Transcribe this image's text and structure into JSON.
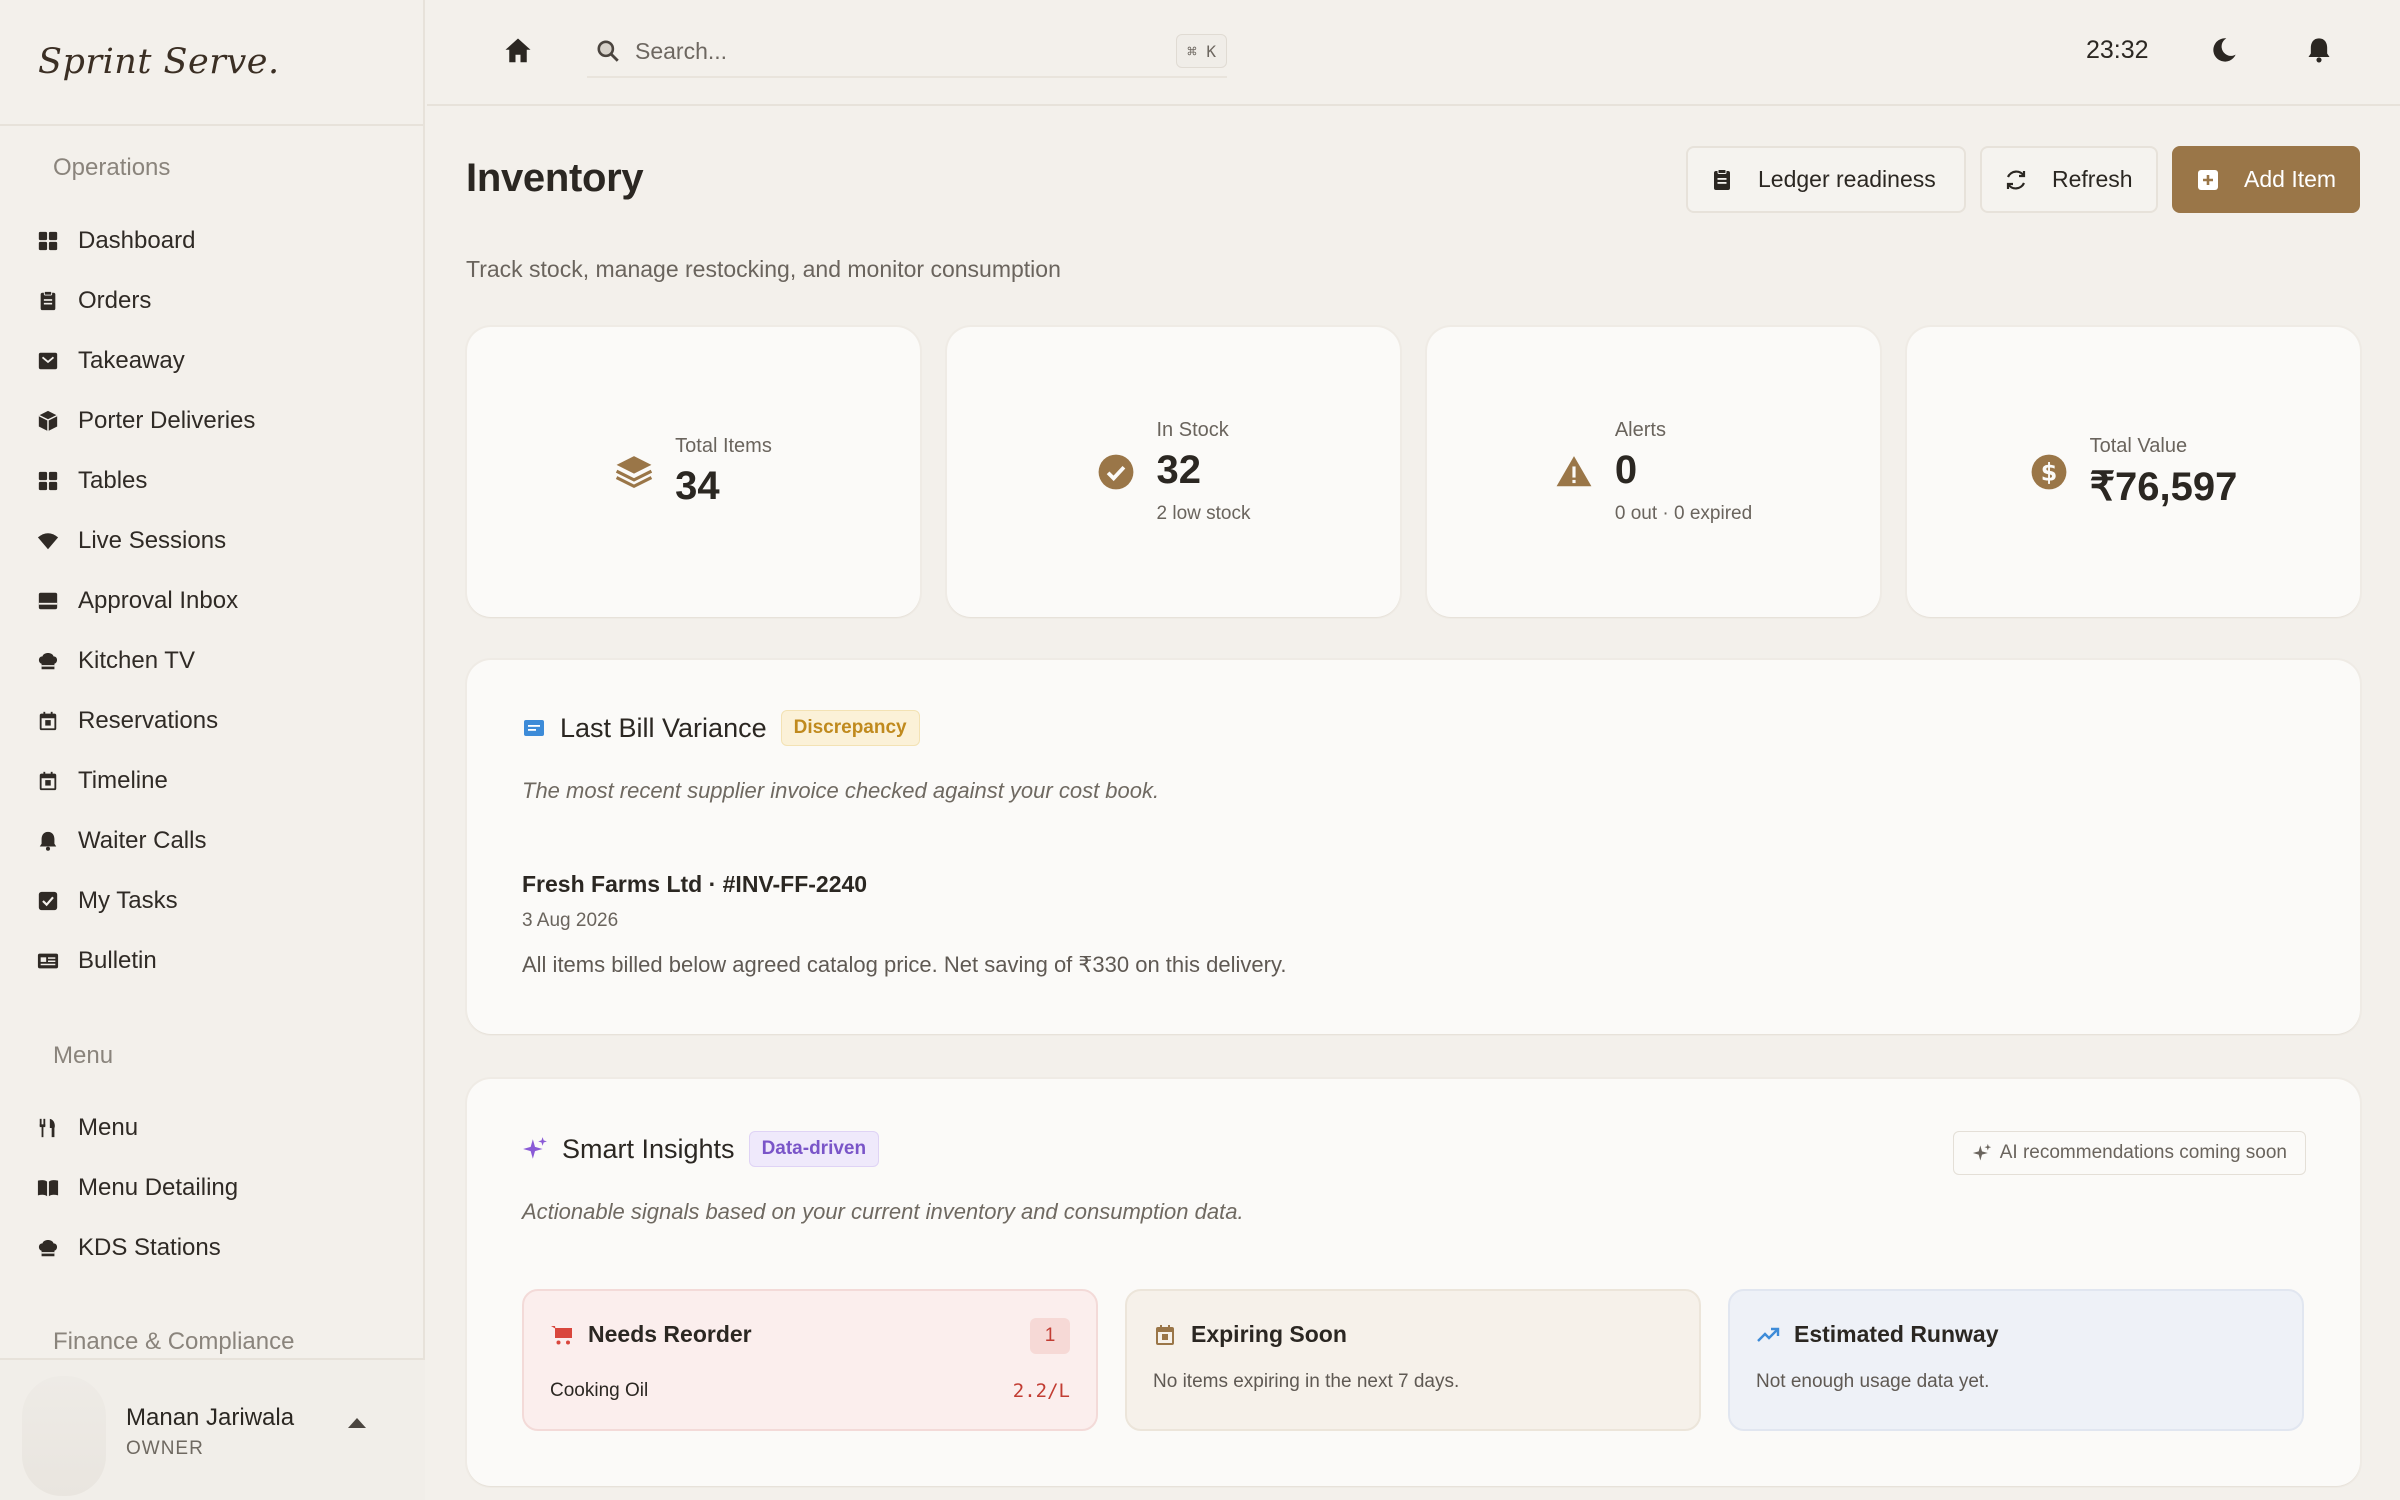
{
  "brand": "Sprint Serve.",
  "sidebar": {
    "sections": [
      {
        "title": "Operations"
      },
      {
        "title": "Menu"
      },
      {
        "title": "Finance & Compliance"
      }
    ],
    "operations": [
      {
        "label": "Dashboard",
        "icon": "grid-icon"
      },
      {
        "label": "Orders",
        "icon": "clipboard-icon"
      },
      {
        "label": "Takeaway",
        "icon": "bag-icon"
      },
      {
        "label": "Porter Deliveries",
        "icon": "box-icon"
      },
      {
        "label": "Tables",
        "icon": "grid-icon"
      },
      {
        "label": "Live Sessions",
        "icon": "wifi-icon"
      },
      {
        "label": "Approval Inbox",
        "icon": "inbox-icon"
      },
      {
        "label": "Kitchen TV",
        "icon": "chef-hat-icon"
      },
      {
        "label": "Reservations",
        "icon": "calendar-icon"
      },
      {
        "label": "Timeline",
        "icon": "calendar-icon"
      },
      {
        "label": "Waiter Calls",
        "icon": "bell-icon"
      },
      {
        "label": "My Tasks",
        "icon": "checkbox-icon"
      },
      {
        "label": "Bulletin",
        "icon": "newspaper-icon"
      }
    ],
    "menu": [
      {
        "label": "Menu",
        "icon": "utensils-icon"
      },
      {
        "label": "Menu Detailing",
        "icon": "book-icon"
      },
      {
        "label": "KDS Stations",
        "icon": "chef-hat-icon"
      }
    ]
  },
  "user": {
    "name": "Manan Jariwala",
    "role": "OWNER"
  },
  "topbar": {
    "search_placeholder": "Search...",
    "shortcut": "⌘ K",
    "time": "23:32"
  },
  "page": {
    "title": "Inventory",
    "subtitle": "Track stock, manage restocking, and monitor consumption",
    "buttons": {
      "ledger": "Ledger readiness",
      "refresh": "Refresh",
      "add": "Add Item"
    }
  },
  "stats": [
    {
      "label": "Total Items",
      "value": "34",
      "sub": "",
      "icon": "layers-icon"
    },
    {
      "label": "In Stock",
      "value": "32",
      "sub": "2 low stock",
      "icon": "check-circle-icon"
    },
    {
      "label": "Alerts",
      "value": "0",
      "sub": "0 out · 0 expired",
      "icon": "warning-icon"
    },
    {
      "label": "Total Value",
      "value": "₹76,597",
      "sub": "",
      "icon": "dollar-icon"
    }
  ],
  "variance": {
    "title": "Last Bill Variance",
    "badge": "Discrepancy",
    "description": "The most recent supplier invoice checked against your cost book.",
    "invoice": "Fresh Farms Ltd · #INV-FF-2240",
    "date": "3 Aug 2026",
    "note": "All items billed below agreed catalog price. Net saving of ₹330 on this delivery."
  },
  "insights": {
    "title": "Smart Insights",
    "badge": "Data-driven",
    "ai_note": "AI recommendations coming soon",
    "description": "Actionable signals based on your current inventory and consumption data.",
    "cards": {
      "reorder": {
        "title": "Needs Reorder",
        "count": "1",
        "item": "Cooking Oil",
        "qty": "2.2/L"
      },
      "expiring": {
        "title": "Expiring Soon",
        "text": "No items expiring in the next 7 days."
      },
      "runway": {
        "title": "Estimated Runway",
        "text": "Not enough usage data yet."
      }
    }
  },
  "colors": {
    "accent": "#9a7648",
    "background": "#f3f0eb",
    "card": "#fbfaf8"
  }
}
